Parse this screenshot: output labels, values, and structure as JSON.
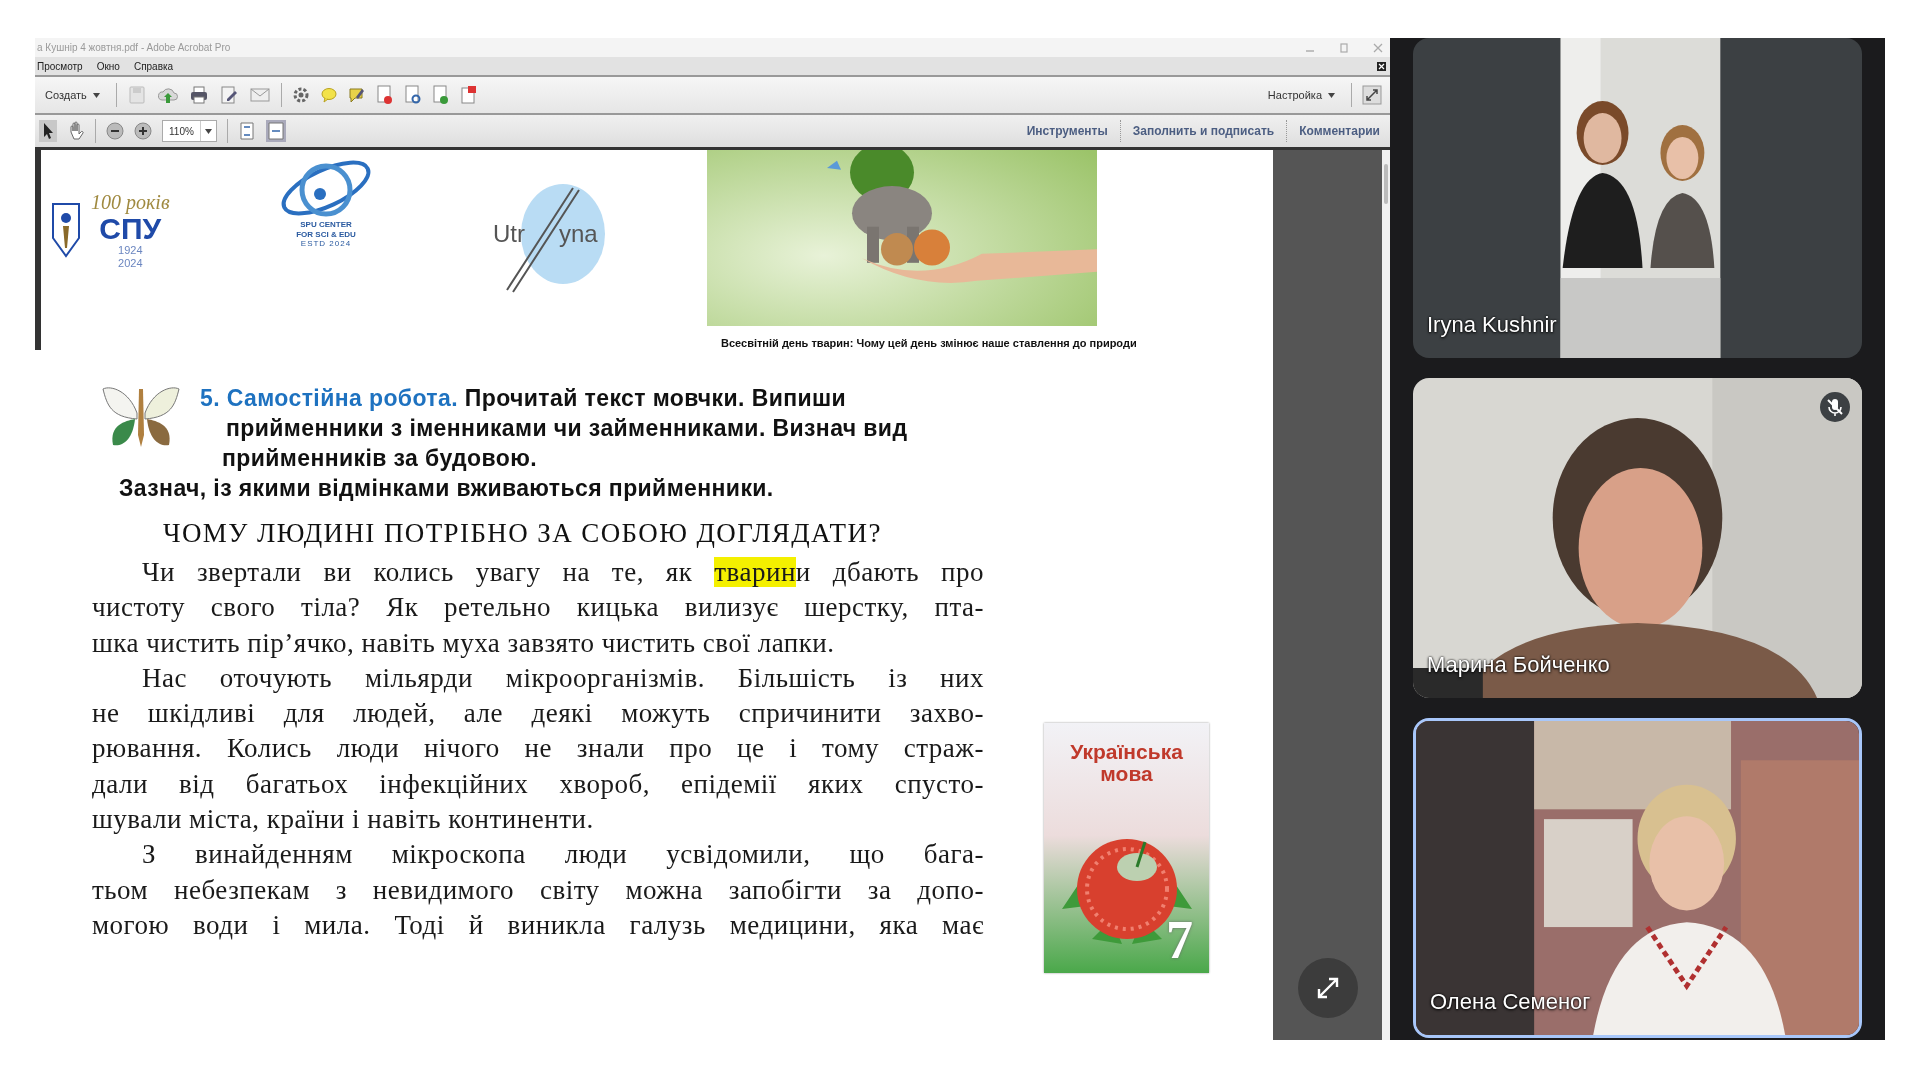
{
  "window": {
    "title": "а Кушнір 4 жовтня.pdf - Adobe Acrobat Pro"
  },
  "menu": [
    "Просмотр",
    "Окно",
    "Справка"
  ],
  "toolbar": {
    "create": "Создать",
    "customize": "Настройка",
    "zoom": "110%"
  },
  "panels": [
    {
      "label": "Инструменты"
    },
    {
      "label": "Заполнить и подписать"
    },
    {
      "label": "Комментарии"
    }
  ],
  "document": {
    "logos": {
      "spu_years": "100 років",
      "spu": "СПУ",
      "spu_start": "1924",
      "spu_end": "2024",
      "center_line_1": "SPU CENTER",
      "center_line_2": "FOR SCI & EDU",
      "center_established": "ESTD 2024",
      "third_left": "Utr",
      "third_right": "yna"
    },
    "photo_caption": "Всесвітній день тварин: Чому цей день змінює наше ставлення до природи",
    "task": {
      "heading": "5. Самостійна робота.",
      "lines": [
        "Прочитай текст мовчки. Випиши",
        "прийменники з іменниками чи займенниками. Визнач вид",
        "прийменників за будовою.",
        "Зазнач, із якими відмінками вживаються прийменники."
      ]
    },
    "text_title": "ЧОМУ ЛЮДИНІ ПОТРІБНО ЗА СОБОЮ ДОГЛЯДАТИ?",
    "paragraphs": [
      {
        "lines": [
          [
            {
              "text": "Чи звертали ви колись увагу на те, як ",
              "highlighted": false
            },
            {
              "text": "тварин",
              "highlighted": true
            },
            {
              "text": "и дбають про",
              "highlighted": false
            }
          ],
          [
            {
              "text": "чистоту свого тіла? Як ретельно кицька вилизує шерстку, пта-",
              "highlighted": false
            }
          ],
          [
            {
              "text": "шка чистить пір’ячко, навіть муха завзято чистить свої лапки.",
              "highlighted": false
            }
          ]
        ]
      },
      {
        "lines": [
          [
            {
              "text": "Нас оточують мільярди мікроорганізмів. Більшість із них",
              "highlighted": false
            }
          ],
          [
            {
              "text": "не шкідливі для людей, але деякі можуть спричинити захво-",
              "highlighted": false
            }
          ],
          [
            {
              "text": "рювання. Колись люди нічого не знали про це і тому страж-",
              "highlighted": false
            }
          ],
          [
            {
              "text": "дали від багатьох інфекційних хвороб, епідемії яких спусто-",
              "highlighted": false
            }
          ],
          [
            {
              "text": "шували міста, країни і навіть континенти.",
              "highlighted": false
            }
          ]
        ]
      },
      {
        "lines": [
          [
            {
              "text": "З винайденням мікроскопа люди усвідомили, що бага-",
              "highlighted": false
            }
          ],
          [
            {
              "text": "тьом небезпекам з невидимого світу можна запобігти за допо-",
              "highlighted": false
            }
          ],
          [
            {
              "text": "могою води і мила. Тоді й виникла галузь медицини, яка має",
              "highlighted": false
            }
          ]
        ]
      }
    ],
    "book": {
      "title": "Українська мова",
      "grade": "7"
    }
  },
  "participants": [
    {
      "name": "Iryna Kushnir",
      "muted": false,
      "speaking": false
    },
    {
      "name": "Марина Бойченко",
      "muted": true,
      "speaking": false
    },
    {
      "name": "Олена Семеног",
      "muted": false,
      "speaking": true
    }
  ]
}
